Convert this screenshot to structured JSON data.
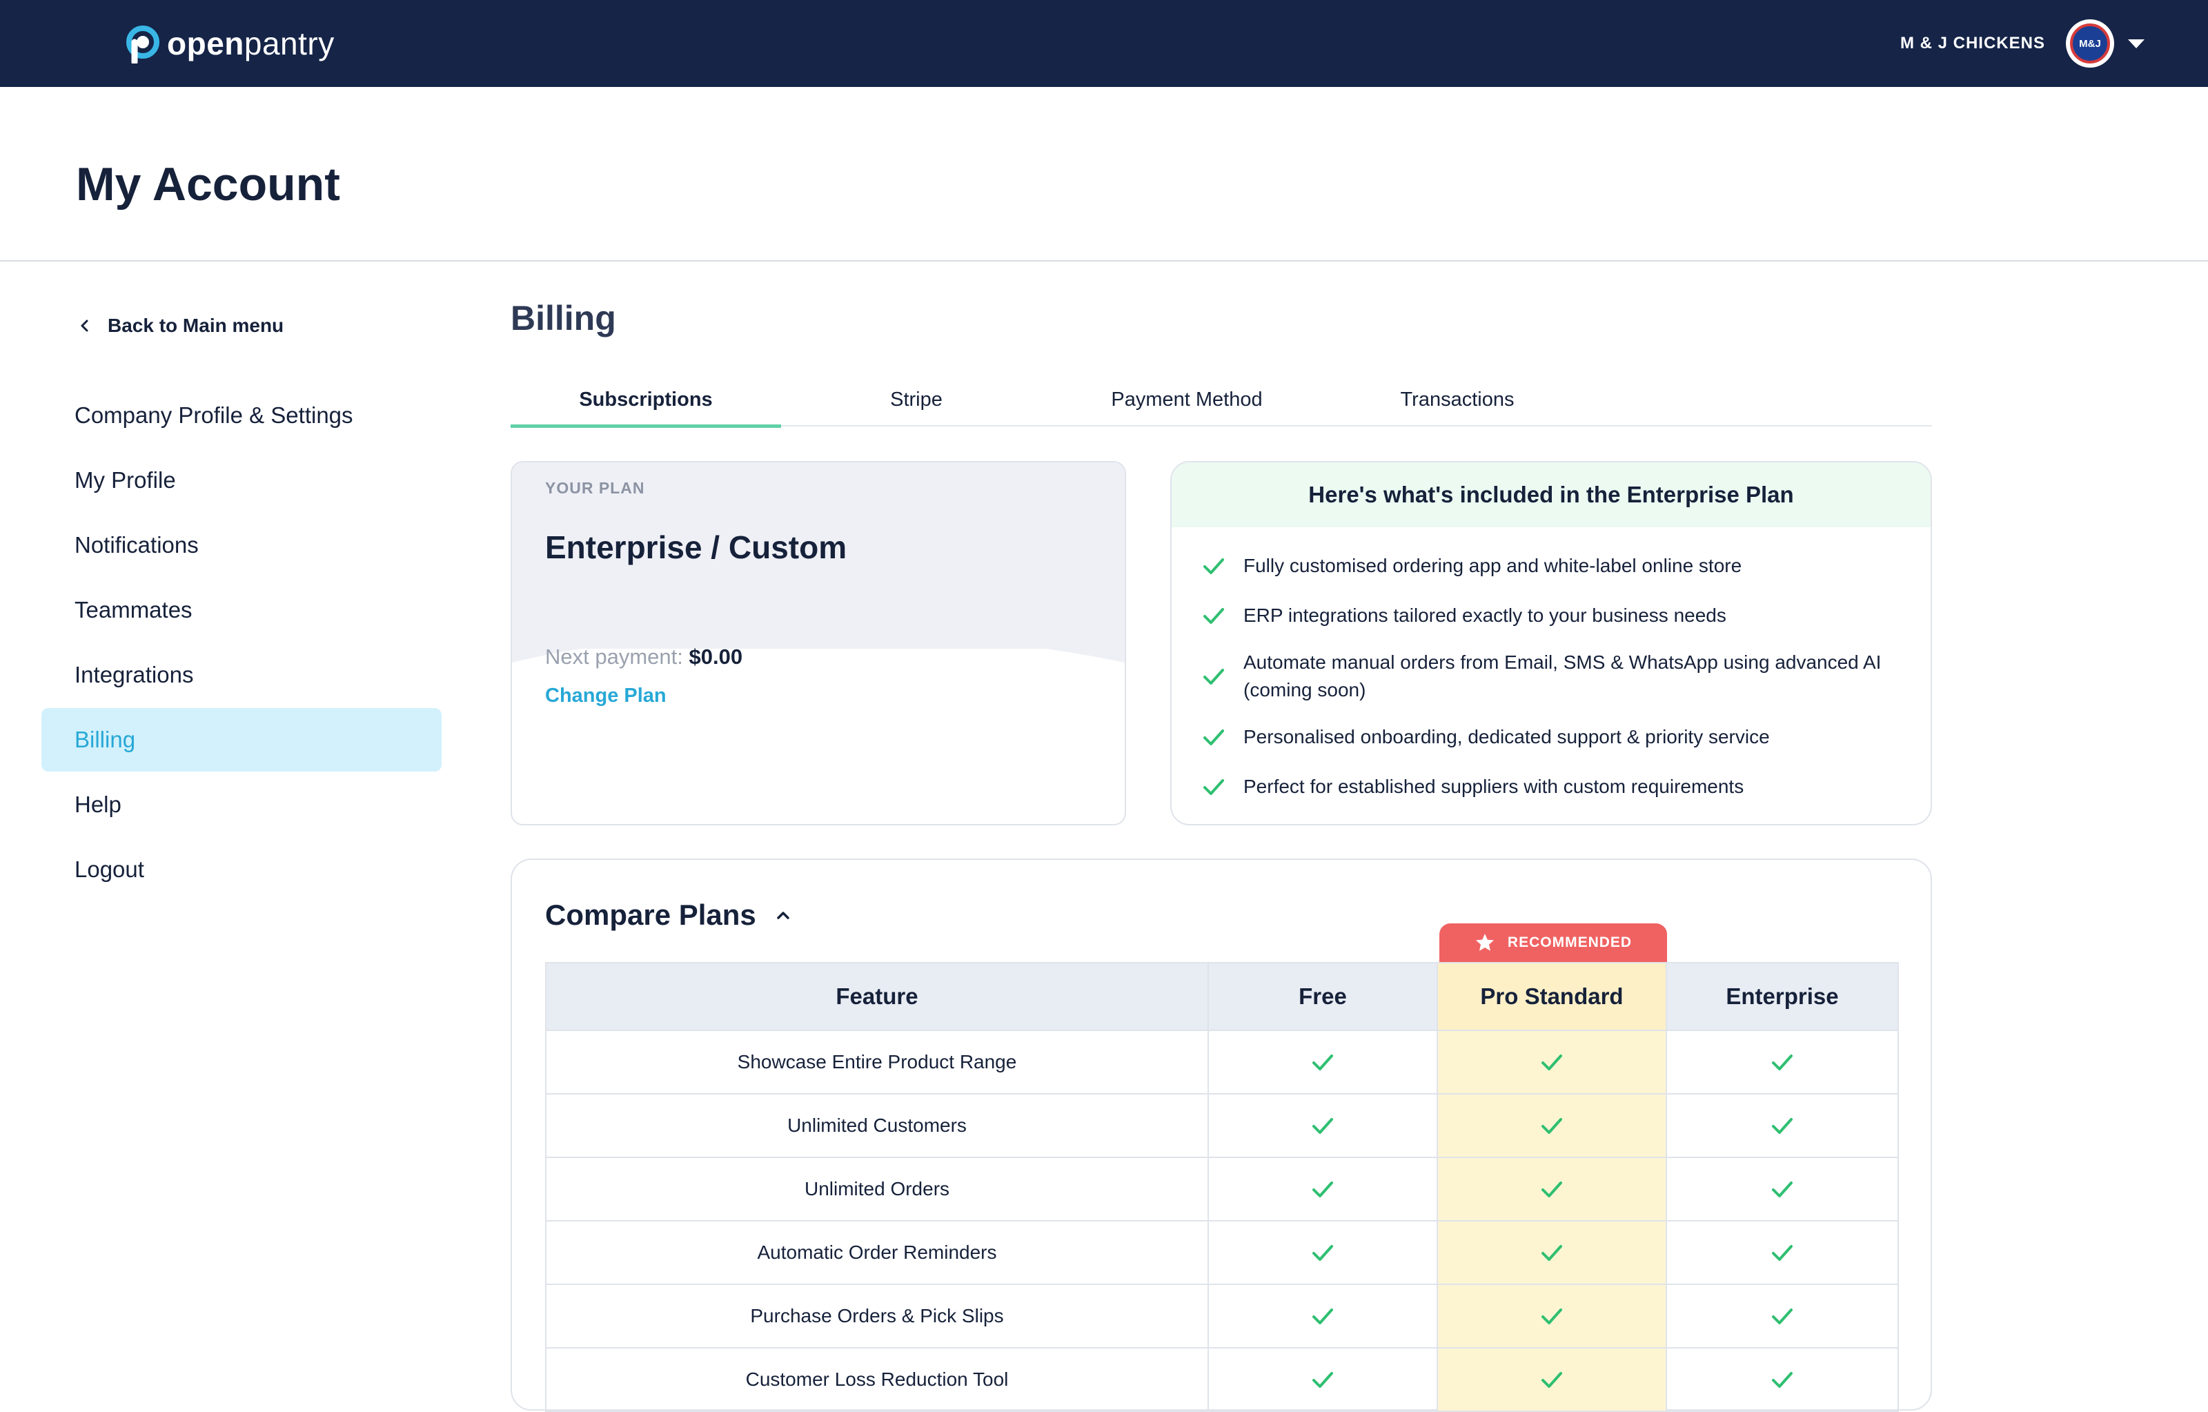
{
  "topbar": {
    "logo_bold": "open",
    "logo_light": "pantry",
    "company_name": "M & J CHICKENS",
    "avatar_text": "M&J"
  },
  "page": {
    "title": "My Account"
  },
  "sidebar": {
    "back_label": "Back to Main menu",
    "items": [
      {
        "label": "Company Profile & Settings"
      },
      {
        "label": "My Profile"
      },
      {
        "label": "Notifications"
      },
      {
        "label": "Teammates"
      },
      {
        "label": "Integrations"
      },
      {
        "label": "Billing",
        "active": true
      },
      {
        "label": "Help"
      },
      {
        "label": "Logout"
      }
    ]
  },
  "billing": {
    "title": "Billing",
    "tabs": [
      {
        "label": "Subscriptions",
        "active": true
      },
      {
        "label": "Stripe"
      },
      {
        "label": "Payment Method"
      },
      {
        "label": "Transactions"
      }
    ],
    "plan": {
      "label": "YOUR PLAN",
      "name": "Enterprise / Custom",
      "next_payment_label": "Next payment:",
      "next_payment_value": "$0.00",
      "change_plan_label": "Change Plan"
    },
    "included": {
      "title": "Here's what's included in the Enterprise Plan",
      "items": [
        "Fully customised ordering app and white-label online store",
        "ERP integrations tailored exactly to your business needs",
        "Automate manual orders from Email, SMS & WhatsApp using advanced AI (coming soon)",
        "Personalised onboarding, dedicated support & priority service",
        "Perfect for established suppliers with custom requirements"
      ]
    },
    "compare": {
      "title": "Compare Plans",
      "recommended_label": "RECOMMENDED",
      "headers": [
        "Feature",
        "Free",
        "Pro Standard",
        "Enterprise"
      ],
      "rows": [
        {
          "feature": "Showcase Entire Product Range",
          "free": true,
          "pro": true,
          "enterprise": true
        },
        {
          "feature": "Unlimited Customers",
          "free": true,
          "pro": true,
          "enterprise": true
        },
        {
          "feature": "Unlimited Orders",
          "free": true,
          "pro": true,
          "enterprise": true
        },
        {
          "feature": "Automatic Order Reminders",
          "free": true,
          "pro": true,
          "enterprise": true
        },
        {
          "feature": "Purchase Orders & Pick Slips",
          "free": true,
          "pro": true,
          "enterprise": true
        },
        {
          "feature": "Customer Loss Reduction Tool",
          "free": true,
          "pro": true,
          "enterprise": true
        }
      ]
    }
  },
  "colors": {
    "navy": "#152447",
    "accent_blue": "#27a8d6",
    "accent_green": "#5fd1a6",
    "check_green": "#2fbf71",
    "recommended_red": "#f06262",
    "recommended_column": "#fdf5d2"
  },
  "icons": {
    "back": "chevron-left-icon",
    "user_menu": "caret-down-icon",
    "collapse": "chevron-up-icon",
    "recommended": "star-icon",
    "included": "check-icon"
  }
}
